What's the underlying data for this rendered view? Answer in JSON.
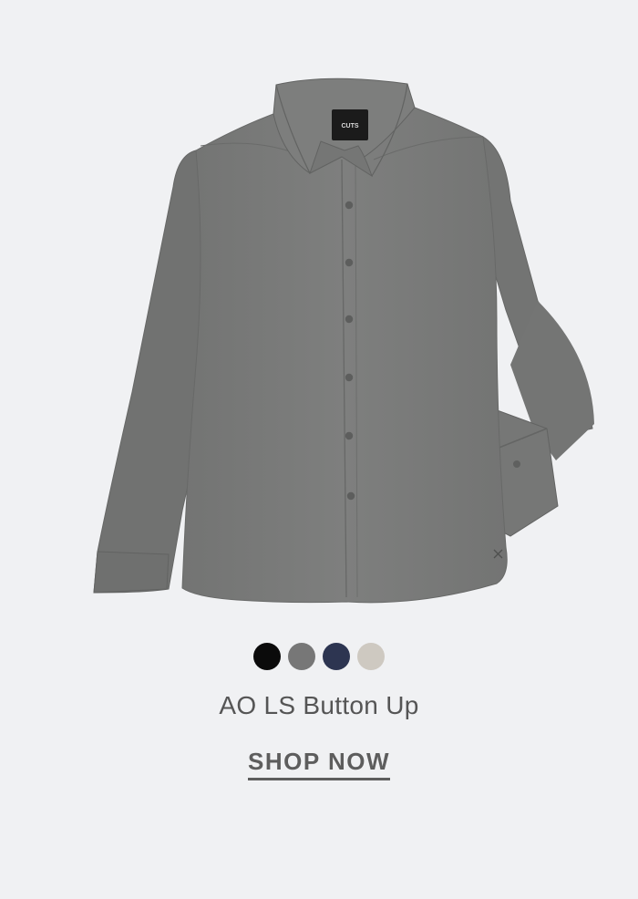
{
  "product": {
    "image_alt": "Grey long sleeve button up shirt",
    "brand_tag": "CUTS",
    "name": "AO LS Button Up",
    "cta_label": "SHOP NOW",
    "colors": [
      "#0b0b0b",
      "#777777",
      "#2d3551",
      "#cec9c1"
    ],
    "shirt_color": "#7b7c7b"
  }
}
